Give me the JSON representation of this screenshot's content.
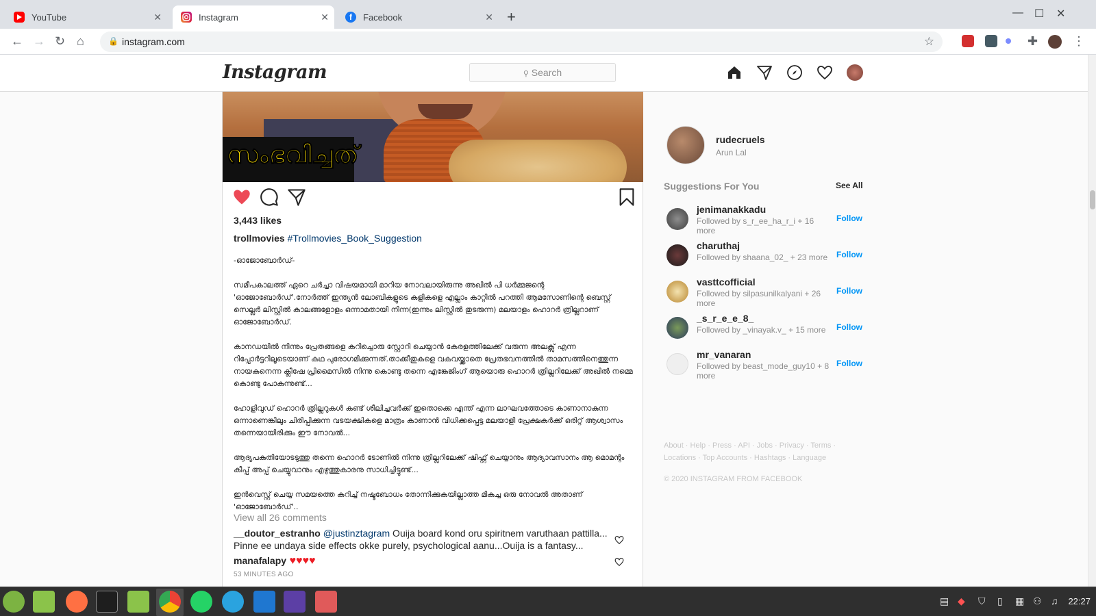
{
  "browser": {
    "tabs": [
      {
        "title": "YouTube",
        "active": false,
        "favicon": "youtube-favicon"
      },
      {
        "title": "Instagram",
        "active": true,
        "favicon": "instagram-favicon"
      },
      {
        "title": "Facebook",
        "active": false,
        "favicon": "facebook-favicon"
      }
    ],
    "url": "instagram.com"
  },
  "instagram": {
    "logo": "Instagram",
    "search_placeholder": "Search",
    "post": {
      "image_caption": "സംഭവിച്ചത്",
      "likes": "3,443 likes",
      "author": "trollmovies",
      "hashtag": "#Trollmovies_Book_Suggestion",
      "body": [
        "-ഓജോബോർഡ്-",
        "സമീപകാലത്ത് ഏറെ ചർച്ചാ വിഷയമായി മാറിയ നോവലായിരുന്നു അഖിൽ പി ധർമ്മജന്റെ 'ഓജോബോർഡ്'.നോർത്ത് ഇന്ത്യൻ ലോബികളുടെ കളികളെ എല്ലാം കാറ്റിൽ പറത്തി ആമസോണിന്റെ ബെസ്റ്റ് സെല്ലർ ലിസ്റ്റിൽ കാലങ്ങളോളം ഒന്നാമതായി നിന്ന(ഇന്നും ലിസ്റ്റിൽ തുടരുന്ന) മലയാളം ഹൊറർ ത്രില്ലറാണ് ഓജോബോർഡ്.",
        "കാനഡയിൽ നിന്നും പ്രേതങ്ങളെ കറിച്ചൊരു സ്റ്റോറി ചെയ്യാൻ കേരളത്തിലേക്ക് വരുന്ന അലക്സ് എന്ന റിപ്പോർട്ടറിലൂടെയാണ് കഥ പുരോഗമിക്കുന്നത്.താക്കീതുകളെ വകവയ്ക്കാതെ പ്രേതഭവനത്തിൽ താമസത്തിനെത്തുന്ന നായകനെന്ന ക്ലീഷേ പ്രിമൈസിൽ നിന്നു കൊണ്ടു തന്നെ എങ്കേജിംഗ് ആയൊരു ഹൊറർ ത്രില്ലറിലേക്ക് അഖിൽ നമ്മെ കൊണ്ടു പോകുന്നുണ്ട്...",
        "ഹോളിവുഡ് ഹൊറർ ത്രില്ലറുകൾ കണ്ട് ശീലിച്ചവർക്ക് ഇതൊക്കെ എന്ത് എന്ന ലാഘവത്തോടെ കാണാനാകുന്ന ഒന്നാണെങ്കിലും ചിരിപ്പിക്കുന്ന വടയക്ഷികളെ മാത്രം കാണാൻ വിധിക്കപ്പെട്ട മലയാളി പ്രേക്ഷകർക്ക് ഒരിറ്റ് ആശ്വാസം തന്നെയായിരിക്കും ഈ നോവൽ...",
        "ആദ്യപകുതിയോടടുത്തു തന്നെ ഹൊറർ ടോണിൽ നിന്നു ത്രില്ലറിലേക്ക് ഷിഫ്റ്റ് ചെയ്യാനും ആദ്യാവസാനം ആ മൊമന്റം കീപ്പ് അപ്പ് ചെയ്യുവാനും എഴുത്തുകാരനു സാധിച്ചിട്ടുണ്ട്...",
        "ഇൻവെസ്റ്റ് ചെയ്യ സമയത്തെ കറിച്ച് നഷ്ടബോധം തോന്നിക്കുകയില്ലാത്ത മികച്ച ഒരു നോവൽ അതാണ് 'ഓജോബോർഡ്'.."
      ],
      "view_all_comments": "View all 26 comments",
      "comments": [
        {
          "user": "__doutor_estranho",
          "mention": "@justinztagram",
          "text": " Ouija board kond oru spiritnem varuthaan pattilla... Pinne ee undaya side effects okke purely, psychological aanu...Ouija is a fantasy..."
        },
        {
          "user": "manafalapy",
          "mention": "",
          "text": " ♥♥♥♥"
        }
      ],
      "time_ago": "53 MINUTES AGO"
    },
    "profile": {
      "username": "rudecruels",
      "name": "Arun Lal"
    },
    "suggestions_title": "Suggestions For You",
    "see_all": "See All",
    "suggestions": [
      {
        "username": "jenimanakkadu",
        "detail": "Followed by s_r_ee_ha_r_i + 16 more",
        "action": "Follow"
      },
      {
        "username": "charuthaj",
        "detail": "Followed by shaana_02_ + 23 more",
        "action": "Follow"
      },
      {
        "username": "vasttcofficial",
        "detail": "Followed by silpasunilkalyani + 26 more",
        "action": "Follow"
      },
      {
        "username": "_s_r_e_e_8_",
        "detail": "Followed by _vinayak.v_ + 15 more",
        "action": "Follow"
      },
      {
        "username": "mr_vanaran",
        "detail": "Followed by beast_mode_guy10 + 8 more",
        "action": "Follow"
      }
    ],
    "footer_links": [
      "About",
      "Help",
      "Press",
      "API",
      "Jobs",
      "Privacy",
      "Terms",
      "Locations",
      "Top Accounts",
      "Hashtags",
      "Language"
    ],
    "copyright": "© 2020 INSTAGRAM FROM FACEBOOK"
  },
  "taskbar": {
    "clock": "22:27"
  },
  "colors": {
    "accent": "#0095f6",
    "heart": "#ed4956",
    "link": "#00376b"
  }
}
